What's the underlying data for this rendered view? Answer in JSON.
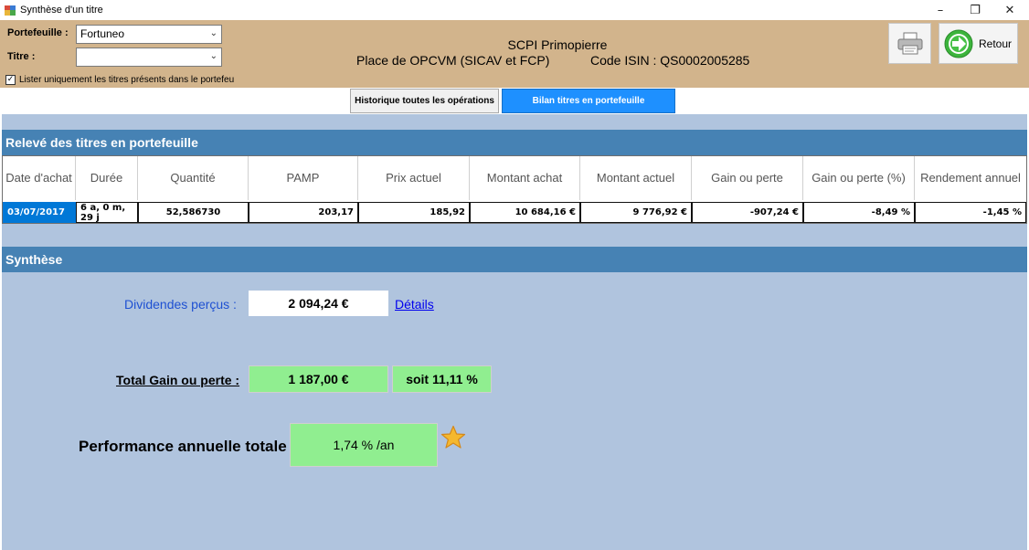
{
  "window": {
    "title": "Synthèse d'un titre",
    "minimize_glyph": "–",
    "maximize_glyph": "❐",
    "close_glyph": "✕"
  },
  "header": {
    "portefeuille_label": "Portefeuille :",
    "portefeuille_value": "Fortuneo",
    "titre_label": "Titre :",
    "titre_value": "",
    "checkbox_label": "Lister uniquement les titres présents dans le portefeu",
    "checkbox_checked": true,
    "fund_name": "SCPI Primopierre",
    "fund_type": "Place de OPCVM (SICAV et FCP)",
    "isin": "Code ISIN : QS0002005285",
    "retour_label": "Retour"
  },
  "tabs": [
    {
      "label": "Historique toutes les opérations",
      "active": false
    },
    {
      "label": "Bilan titres en portefeuille",
      "active": true
    }
  ],
  "releve": {
    "title": "Relevé des titres en portefeuille",
    "columns": [
      "Date d'achat",
      "Durée",
      "Quantité",
      "PAMP",
      "Prix actuel",
      "Montant achat",
      "Montant actuel",
      "Gain ou perte",
      "Gain ou perte (%)",
      "Rendement annuel"
    ],
    "rows": [
      [
        "03/07/2017",
        "6 a, 0 m, 29 j",
        "52,586730",
        "203,17",
        "185,92",
        "10 684,16 €",
        "9 776,92 €",
        "-907,24 €",
        "-8,49 %",
        "-1,45 %"
      ]
    ]
  },
  "synthese": {
    "title": "Synthèse",
    "dividendes_label": "Dividendes perçus :",
    "dividendes_value": "2 094,24 €",
    "details_link": "Détails",
    "total_label": "Total Gain ou perte :",
    "total_value": "1 187,00 €",
    "soit_value": "soit 11,11 %",
    "perf_label": "Performance annuelle totale",
    "perf_value": "1,74 % /an"
  },
  "colors": {
    "header_bg": "#d2b48c",
    "section_bar": "#4682b4",
    "main_bg": "#b0c4de",
    "active_tab": "#1e90ff",
    "highlight_green": "#90ee90",
    "selected_cell": "#0078d7"
  },
  "icons": {
    "app": "app-icon",
    "print": "printer-icon",
    "retour": "arrow-right-circle-icon",
    "star": "star-icon"
  }
}
